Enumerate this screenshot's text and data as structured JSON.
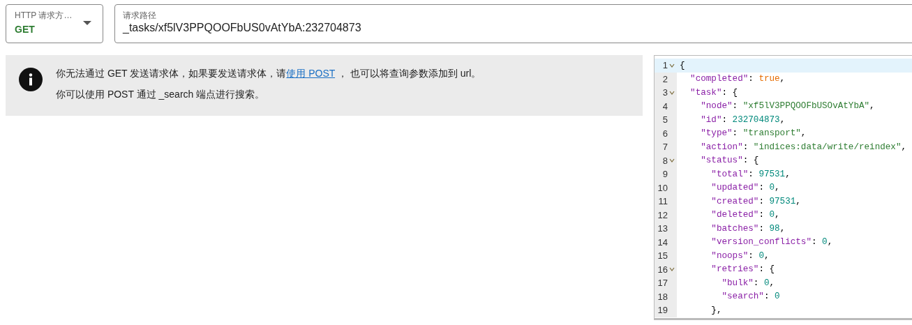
{
  "method_select": {
    "label": "HTTP 请求方…",
    "value": "GET"
  },
  "path_field": {
    "label": "请求路径",
    "value": "_tasks/xf5lV3PPQOOFbUS0vAtYbA:232704873"
  },
  "notice": {
    "lines": [
      {
        "before": "你无法通过 GET 发送请求体，如果要发送请求体，请",
        "link": "使用 POST",
        "after": " ， 也可以将查询参数添加到 url。"
      },
      {
        "before": "你可以使用 POST 通过 _search 端点进行搜索。"
      }
    ]
  },
  "editor": {
    "lines": [
      {
        "number": "1",
        "foldable": true,
        "selected": true,
        "tokens": [
          {
            "kind": "punct",
            "text": "{"
          }
        ]
      },
      {
        "number": "2",
        "foldable": false,
        "selected": false,
        "tokens": [
          {
            "kind": "key",
            "text": "  \"completed\""
          },
          {
            "kind": "punct",
            "text": ": "
          },
          {
            "kind": "bool",
            "text": "true"
          },
          {
            "kind": "punct",
            "text": ","
          }
        ]
      },
      {
        "number": "3",
        "foldable": true,
        "selected": false,
        "tokens": [
          {
            "kind": "key",
            "text": "  \"task\""
          },
          {
            "kind": "punct",
            "text": ": {"
          }
        ]
      },
      {
        "number": "4",
        "foldable": false,
        "selected": false,
        "tokens": [
          {
            "kind": "key",
            "text": "    \"node\""
          },
          {
            "kind": "punct",
            "text": ": "
          },
          {
            "kind": "string",
            "text": "\"xf5lV3PPQOOFbUSOvAtYbA\""
          },
          {
            "kind": "punct",
            "text": ","
          }
        ]
      },
      {
        "number": "5",
        "foldable": false,
        "selected": false,
        "tokens": [
          {
            "kind": "key",
            "text": "    \"id\""
          },
          {
            "kind": "punct",
            "text": ": "
          },
          {
            "kind": "number",
            "text": "232704873"
          },
          {
            "kind": "punct",
            "text": ","
          }
        ]
      },
      {
        "number": "6",
        "foldable": false,
        "selected": false,
        "tokens": [
          {
            "kind": "key",
            "text": "    \"type\""
          },
          {
            "kind": "punct",
            "text": ": "
          },
          {
            "kind": "string",
            "text": "\"transport\""
          },
          {
            "kind": "punct",
            "text": ","
          }
        ]
      },
      {
        "number": "7",
        "foldable": false,
        "selected": false,
        "tokens": [
          {
            "kind": "key",
            "text": "    \"action\""
          },
          {
            "kind": "punct",
            "text": ": "
          },
          {
            "kind": "string",
            "text": "\"indices:data/write/reindex\""
          },
          {
            "kind": "punct",
            "text": ","
          }
        ]
      },
      {
        "number": "8",
        "foldable": true,
        "selected": false,
        "tokens": [
          {
            "kind": "key",
            "text": "    \"status\""
          },
          {
            "kind": "punct",
            "text": ": {"
          }
        ]
      },
      {
        "number": "9",
        "foldable": false,
        "selected": false,
        "tokens": [
          {
            "kind": "key",
            "text": "      \"total\""
          },
          {
            "kind": "punct",
            "text": ": "
          },
          {
            "kind": "number",
            "text": "97531"
          },
          {
            "kind": "punct",
            "text": ","
          }
        ]
      },
      {
        "number": "10",
        "foldable": false,
        "selected": false,
        "tokens": [
          {
            "kind": "key",
            "text": "      \"updated\""
          },
          {
            "kind": "punct",
            "text": ": "
          },
          {
            "kind": "number",
            "text": "0"
          },
          {
            "kind": "punct",
            "text": ","
          }
        ]
      },
      {
        "number": "11",
        "foldable": false,
        "selected": false,
        "tokens": [
          {
            "kind": "key",
            "text": "      \"created\""
          },
          {
            "kind": "punct",
            "text": ": "
          },
          {
            "kind": "number",
            "text": "97531"
          },
          {
            "kind": "punct",
            "text": ","
          }
        ]
      },
      {
        "number": "12",
        "foldable": false,
        "selected": false,
        "tokens": [
          {
            "kind": "key",
            "text": "      \"deleted\""
          },
          {
            "kind": "punct",
            "text": ": "
          },
          {
            "kind": "number",
            "text": "0"
          },
          {
            "kind": "punct",
            "text": ","
          }
        ]
      },
      {
        "number": "13",
        "foldable": false,
        "selected": false,
        "tokens": [
          {
            "kind": "key",
            "text": "      \"batches\""
          },
          {
            "kind": "punct",
            "text": ": "
          },
          {
            "kind": "number",
            "text": "98"
          },
          {
            "kind": "punct",
            "text": ","
          }
        ]
      },
      {
        "number": "14",
        "foldable": false,
        "selected": false,
        "tokens": [
          {
            "kind": "key",
            "text": "      \"version_conflicts\""
          },
          {
            "kind": "punct",
            "text": ": "
          },
          {
            "kind": "number",
            "text": "0"
          },
          {
            "kind": "punct",
            "text": ","
          }
        ]
      },
      {
        "number": "15",
        "foldable": false,
        "selected": false,
        "tokens": [
          {
            "kind": "key",
            "text": "      \"noops\""
          },
          {
            "kind": "punct",
            "text": ": "
          },
          {
            "kind": "number",
            "text": "0"
          },
          {
            "kind": "punct",
            "text": ","
          }
        ]
      },
      {
        "number": "16",
        "foldable": true,
        "selected": false,
        "tokens": [
          {
            "kind": "key",
            "text": "      \"retries\""
          },
          {
            "kind": "punct",
            "text": ": {"
          }
        ]
      },
      {
        "number": "17",
        "foldable": false,
        "selected": false,
        "tokens": [
          {
            "kind": "key",
            "text": "        \"bulk\""
          },
          {
            "kind": "punct",
            "text": ": "
          },
          {
            "kind": "number",
            "text": "0"
          },
          {
            "kind": "punct",
            "text": ","
          }
        ]
      },
      {
        "number": "18",
        "foldable": false,
        "selected": false,
        "tokens": [
          {
            "kind": "key",
            "text": "        \"search\""
          },
          {
            "kind": "punct",
            "text": ": "
          },
          {
            "kind": "number",
            "text": "0"
          }
        ]
      },
      {
        "number": "19",
        "foldable": false,
        "selected": false,
        "tokens": [
          {
            "kind": "punct",
            "text": "      },"
          }
        ]
      }
    ]
  }
}
